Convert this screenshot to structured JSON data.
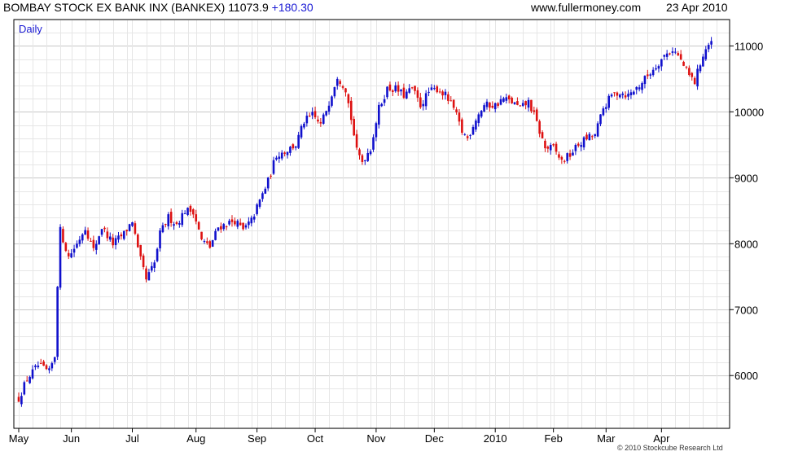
{
  "header": {
    "instrument": "BOMBAY STOCK EX BANK INX (BANKEX)",
    "last": "11073.9",
    "change": "+180.30",
    "site": "www.fullermoney.com",
    "date": "23 Apr 2010"
  },
  "footer": "© 2010 Stockcube Research Ltd",
  "chart_data": {
    "type": "candlestick",
    "period_label": "Daily",
    "ylim": [
      5200,
      11400
    ],
    "y_ticks": [
      6000,
      7000,
      8000,
      9000,
      10000,
      11000
    ],
    "y_tick_labels": [
      "6000",
      "7000",
      "8000",
      "9000",
      "10000",
      "11000"
    ],
    "x_ticks": [
      "May",
      "Jun",
      "Jul",
      "Aug",
      "Sep",
      "Oct",
      "Nov",
      "Dec",
      "2010",
      "Feb",
      "Mar",
      "Apr"
    ],
    "x_tick_day_index": [
      0,
      19,
      41,
      64,
      86,
      107,
      129,
      150,
      172,
      193,
      212,
      232
    ],
    "total_days": 256,
    "grid": true,
    "colors": {
      "up": "#1010cc",
      "down": "#dd1111",
      "grid": "#e6e6e6",
      "grid_major": "#c8c8c8",
      "axis": "#000000"
    },
    "close_path": [
      [
        0,
        5650
      ],
      [
        3,
        5950
      ],
      [
        7,
        6150
      ],
      [
        11,
        6050
      ],
      [
        13,
        6300
      ],
      [
        14,
        7400
      ],
      [
        15,
        8200
      ],
      [
        18,
        7800
      ],
      [
        21,
        8000
      ],
      [
        24,
        8250
      ],
      [
        27,
        7900
      ],
      [
        30,
        8250
      ],
      [
        34,
        8000
      ],
      [
        38,
        8150
      ],
      [
        41,
        8350
      ],
      [
        43,
        7900
      ],
      [
        46,
        7450
      ],
      [
        49,
        7700
      ],
      [
        51,
        8150
      ],
      [
        54,
        8400
      ],
      [
        57,
        8300
      ],
      [
        60,
        8500
      ],
      [
        63,
        8500
      ],
      [
        66,
        8050
      ],
      [
        69,
        7950
      ],
      [
        72,
        8250
      ],
      [
        75,
        8300
      ],
      [
        78,
        8350
      ],
      [
        81,
        8200
      ],
      [
        84,
        8350
      ],
      [
        87,
        8650
      ],
      [
        90,
        8950
      ],
      [
        93,
        9350
      ],
      [
        96,
        9400
      ],
      [
        100,
        9500
      ],
      [
        103,
        9850
      ],
      [
        106,
        9950
      ],
      [
        109,
        9800
      ],
      [
        112,
        10150
      ],
      [
        115,
        10550
      ],
      [
        118,
        10350
      ],
      [
        120,
        9900
      ],
      [
        122,
        9400
      ],
      [
        124,
        9250
      ],
      [
        127,
        9450
      ],
      [
        130,
        10050
      ],
      [
        133,
        10350
      ],
      [
        136,
        10350
      ],
      [
        139,
        10250
      ],
      [
        142,
        10350
      ],
      [
        145,
        10100
      ],
      [
        148,
        10300
      ],
      [
        151,
        10350
      ],
      [
        154,
        10250
      ],
      [
        157,
        10050
      ],
      [
        160,
        9700
      ],
      [
        162,
        9600
      ],
      [
        165,
        9900
      ],
      [
        168,
        10100
      ],
      [
        172,
        10100
      ],
      [
        175,
        10200
      ],
      [
        178,
        10150
      ],
      [
        181,
        10050
      ],
      [
        184,
        10150
      ],
      [
        186,
        9950
      ],
      [
        188,
        9700
      ],
      [
        190,
        9450
      ],
      [
        193,
        9450
      ],
      [
        196,
        9250
      ],
      [
        199,
        9350
      ],
      [
        202,
        9500
      ],
      [
        205,
        9600
      ],
      [
        208,
        9650
      ],
      [
        211,
        10050
      ],
      [
        214,
        10250
      ],
      [
        217,
        10300
      ],
      [
        220,
        10250
      ],
      [
        224,
        10400
      ],
      [
        227,
        10550
      ],
      [
        230,
        10700
      ],
      [
        233,
        10850
      ],
      [
        236,
        10950
      ],
      [
        238,
        10850
      ],
      [
        240,
        10700
      ],
      [
        242,
        10550
      ],
      [
        244,
        10450
      ],
      [
        246,
        10750
      ],
      [
        248,
        10950
      ],
      [
        250,
        11074
      ]
    ],
    "last_close": 11073.9
  }
}
